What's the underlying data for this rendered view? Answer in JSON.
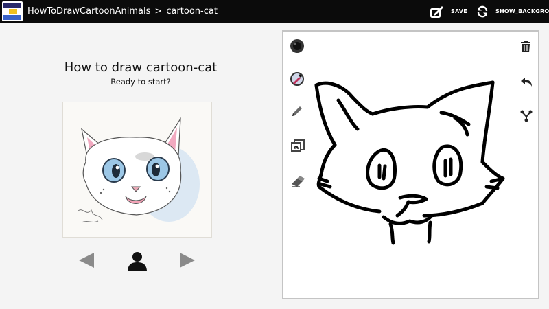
{
  "app": {
    "logo_name": "how-to-draw-logo",
    "breadcrumb": {
      "parent": "HowToDrawCartoonAnimals",
      "separator": ">",
      "current": "cartoon-cat"
    }
  },
  "toolbar": {
    "save_label": "SAVE",
    "show_background_label": "SHOW_BACKGROUND"
  },
  "lesson": {
    "title": "How to draw cartoon-cat",
    "subtitle": "Ready to start?"
  },
  "canvas_tools": {
    "left": [
      "brush-size-icon",
      "color-picker-icon",
      "pencil-icon",
      "text-stamp-icon",
      "eraser-icon"
    ],
    "right": [
      "trash-icon",
      "undo-icon",
      "share-icon"
    ]
  },
  "colors": {
    "topbar": "#0b0b0b",
    "background": "#f4f4f4",
    "canvas_border": "#c4c4c4",
    "stroke": "#000000",
    "nav_arrow": "#8a8a8a"
  }
}
